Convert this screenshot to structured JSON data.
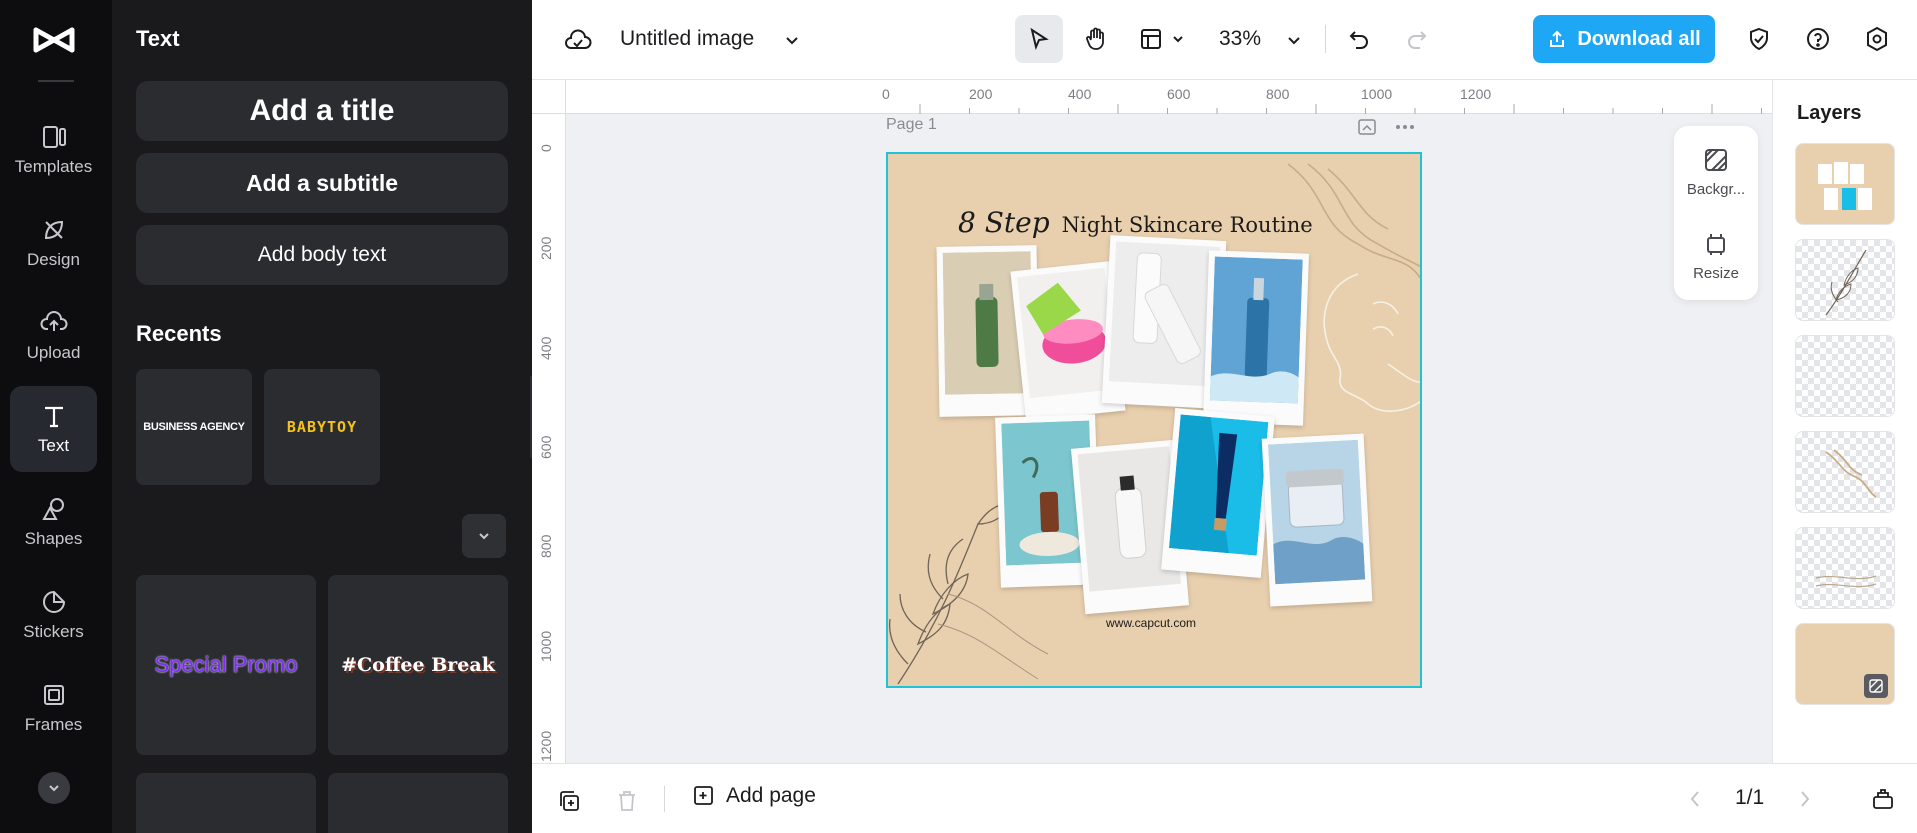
{
  "rail": {
    "items": [
      {
        "label": "Templates",
        "icon": "templates-icon"
      },
      {
        "label": "Design",
        "icon": "design-icon"
      },
      {
        "label": "Upload",
        "icon": "upload-icon"
      },
      {
        "label": "Text",
        "icon": "text-icon",
        "active": true
      },
      {
        "label": "Shapes",
        "icon": "shapes-icon"
      },
      {
        "label": "Stickers",
        "icon": "stickers-icon"
      },
      {
        "label": "Frames",
        "icon": "frames-icon"
      }
    ]
  },
  "panel": {
    "title": "Text",
    "add_title": "Add a title",
    "add_subtitle": "Add a subtitle",
    "add_body": "Add body text",
    "recents_label": "Recents",
    "recents": [
      "BUSINESS AGENCY",
      "BABYTOY"
    ],
    "templates": [
      "Special Promo",
      "#Coffee Break"
    ]
  },
  "topbar": {
    "doc_title": "Untitled image",
    "zoom": "33%",
    "download_label": "Download all"
  },
  "canvas": {
    "page_label": "Page 1",
    "ruler_h": [
      "0",
      "200",
      "400",
      "600",
      "800",
      "1000",
      "1200"
    ],
    "ruler_v": [
      "0",
      "200",
      "400",
      "600",
      "800",
      "1000",
      "1200"
    ],
    "design": {
      "title_script": "8 Step",
      "title_rest": "Night Skincare Routine",
      "url": "www.capcut.com",
      "background": "#e8cfae"
    }
  },
  "float_tools": {
    "background_label": "Backgr...",
    "resize_label": "Resize"
  },
  "layers": {
    "title": "Layers"
  },
  "bottombar": {
    "add_page_label": "Add page",
    "pager": "1/1"
  },
  "colors": {
    "accent": "#1ea7f4",
    "selection": "#1fc3d8",
    "rail_bg": "#0d0d0f",
    "panel_bg": "#1a1a1d"
  }
}
